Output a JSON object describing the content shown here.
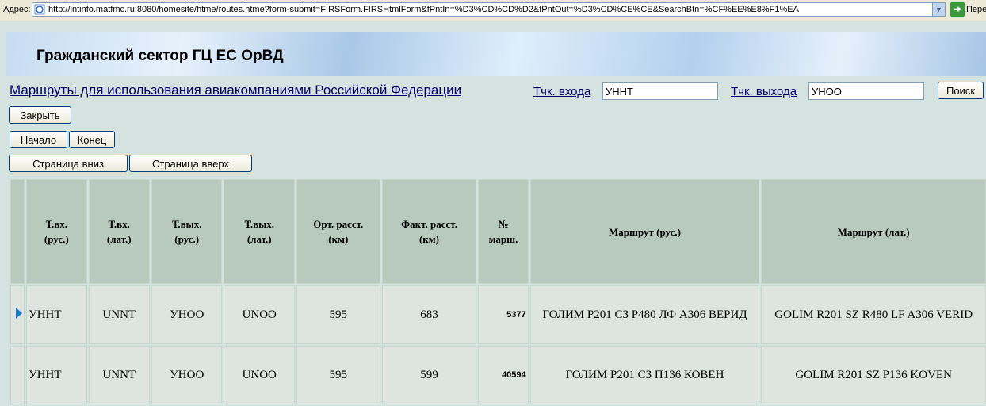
{
  "address_bar": {
    "label": "Адрес:",
    "url": "http://intinfo.matfmc.ru:8080/homesite/htme/routes.htme?form-submit=FIRSForm.FIRSHtmlForm&fPntIn=%D3%CD%CD%D2&fPntOut=%D3%CD%CE%CE&SearchBtn=%CF%EE%E8%F1%EA",
    "go_label": "Перех"
  },
  "banner": {
    "title": "Гражданский сектор ГЦ ЕС ОрВД"
  },
  "heading": "Маршруты для использования авиакомпаниями Российской Федерации",
  "search": {
    "entry_label": "Тчк. входа",
    "entry_value": "УННТ",
    "exit_label": "Тчк. выхода",
    "exit_value": "УНОО",
    "search_button": "Поиск"
  },
  "buttons": {
    "close": "Закрыть",
    "first": "Начало",
    "last": "Конец",
    "page_down": "Страница вниз",
    "page_up": "Страница вверх"
  },
  "table": {
    "columns": [
      [
        "Т.вх.",
        "(рус.)"
      ],
      [
        "Т.вх.",
        "(лат.)"
      ],
      [
        "Т.вых.",
        "(рус.)"
      ],
      [
        "Т.вых.",
        "(лат.)"
      ],
      [
        "Орт. расст.",
        "(км)"
      ],
      [
        "Факт. расст.",
        "(км)"
      ],
      [
        "№",
        "марш."
      ],
      [
        "Маршрут (рус.)"
      ],
      [
        "Маршрут (лат.)"
      ]
    ],
    "rows": [
      [
        "УННТ",
        "UNNT",
        "УНОО",
        "UNOO",
        "595",
        "683",
        "5377",
        "ГОЛИМ Р201 СЗ Р480 ЛФ А306 ВЕРИД",
        "GOLIM R201 SZ R480 LF A306 VERID"
      ],
      [
        "УННТ",
        "UNNT",
        "УНОО",
        "UNOO",
        "595",
        "599",
        "40594",
        "ГОЛИМ Р201 СЗ П136 КОВЕН",
        "GOLIM R201 SZ P136 KOVEN"
      ]
    ]
  }
}
